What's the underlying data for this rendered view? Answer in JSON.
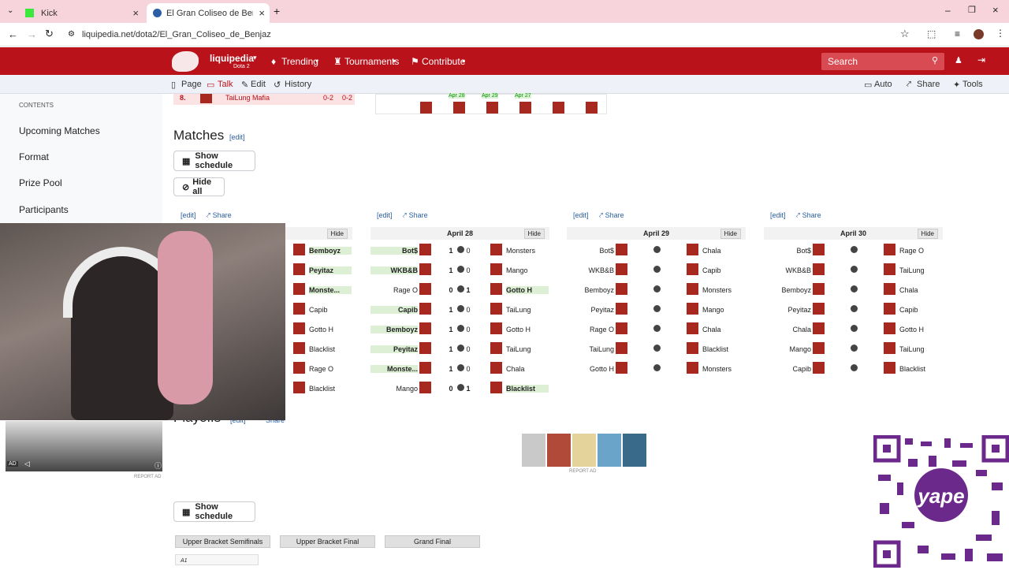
{
  "browser": {
    "tabs": [
      {
        "title": "Kick",
        "active": false
      },
      {
        "title": "El Gran Coliseo de Benjaz - Liqu",
        "active": true
      }
    ],
    "url": "liquipedia.net/dota2/El_Gran_Coliseo_de_Benjaz"
  },
  "nav": {
    "brand": "liquipedia",
    "brand_sub": "Dota 2",
    "items": [
      "Trending",
      "Tournaments",
      "Contribute"
    ],
    "search_placeholder": "Search"
  },
  "subnav": {
    "left": [
      "Page",
      "Talk",
      "Edit",
      "History"
    ],
    "right": [
      "Auto",
      "Share",
      "Tools"
    ]
  },
  "sidebar": {
    "header": "CONTENTS",
    "links": [
      "Upcoming Matches",
      "Format",
      "Prize Pool",
      "Participants"
    ]
  },
  "top_fragment": {
    "row_num": "8.",
    "team": "TaiLung Mafia",
    "score1": "0-2",
    "score2": "0-2",
    "dates": [
      "Apr 28",
      "Apr 29",
      "Apr 27"
    ]
  },
  "matches": {
    "title": "Matches",
    "edit": "[edit]",
    "show_schedule": "Show schedule",
    "hide_all": "Hide all",
    "share": "Share",
    "hide": "Hide",
    "days": [
      {
        "date": "",
        "rows": [
          {
            "r": "Bemboyz",
            "win": "r"
          },
          {
            "r": "Peyitaz",
            "win": "r"
          },
          {
            "r": "Monste...",
            "win": "r"
          },
          {
            "r": "Capib",
            "win": ""
          },
          {
            "r": "Gotto H",
            "win": ""
          },
          {
            "r": "Blacklist",
            "win": ""
          },
          {
            "r": "Rage O",
            "win": ""
          },
          {
            "r": "Blacklist",
            "win": ""
          }
        ]
      },
      {
        "date": "April 28",
        "rows": [
          {
            "l": "Bot$",
            "s1": "1",
            "s2": "0",
            "r": "Monsters",
            "win": "l"
          },
          {
            "l": "WKB&B",
            "s1": "1",
            "s2": "0",
            "r": "Mango",
            "win": "l"
          },
          {
            "l": "Rage O",
            "s1": "0",
            "s2": "1",
            "r": "Gotto H",
            "win": "r"
          },
          {
            "l": "Capib",
            "s1": "1",
            "s2": "0",
            "r": "TaiLung",
            "win": "l"
          },
          {
            "l": "Bemboyz",
            "s1": "1",
            "s2": "0",
            "r": "Gotto H",
            "win": "l"
          },
          {
            "l": "Peyitaz",
            "s1": "1",
            "s2": "0",
            "r": "TaiLung",
            "win": "l"
          },
          {
            "l": "Monste...",
            "s1": "1",
            "s2": "0",
            "r": "Chala",
            "win": "l"
          },
          {
            "l": "Mango",
            "s1": "0",
            "s2": "1",
            "r": "Blacklist",
            "win": "r"
          }
        ]
      },
      {
        "date": "April 29",
        "rows": [
          {
            "l": "Bot$",
            "r": "Chala"
          },
          {
            "l": "WKB&B",
            "r": "Capib"
          },
          {
            "l": "Bemboyz",
            "r": "Monsters"
          },
          {
            "l": "Peyitaz",
            "r": "Mango"
          },
          {
            "l": "Rage O",
            "r": "Chala"
          },
          {
            "l": "TaiLung",
            "r": "Blacklist"
          },
          {
            "l": "Gotto H",
            "r": "Monsters"
          }
        ]
      },
      {
        "date": "April 30",
        "rows": [
          {
            "l": "Bot$",
            "r": "Rage O"
          },
          {
            "l": "WKB&B",
            "r": "TaiLung"
          },
          {
            "l": "Bemboyz",
            "r": "Chala"
          },
          {
            "l": "Peyitaz",
            "r": "Capib"
          },
          {
            "l": "Chala",
            "r": "Gotto H"
          },
          {
            "l": "Mango",
            "r": "TaiLung"
          },
          {
            "l": "Capib",
            "r": "Blacklist"
          }
        ]
      }
    ]
  },
  "playoffs": {
    "title": "Playoffs",
    "edit": "[edit]",
    "share": "Share",
    "show_schedule": "Show schedule",
    "tabs": [
      "Upper Bracket Semifinals",
      "Upper Bracket Final",
      "Grand Final"
    ],
    "first_label": "A1"
  },
  "ads": {
    "report": "REPORT AD",
    "ad_label": "AD"
  }
}
